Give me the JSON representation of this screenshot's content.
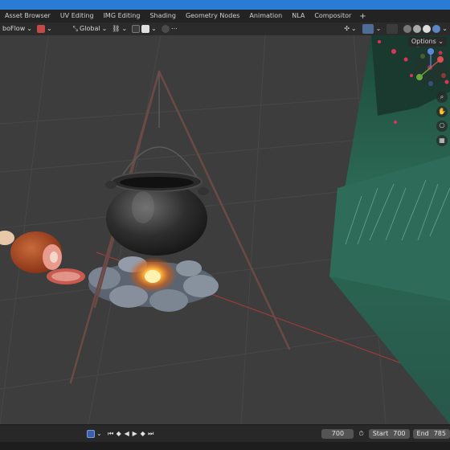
{
  "workspace_tabs": [
    "Asset Browser",
    "UV Editing",
    "IMG Editing",
    "Shading",
    "Geometry Nodes",
    "Animation",
    "NLA",
    "Compositor"
  ],
  "add_tab_symbol": "+",
  "header": {
    "mode_label": "boFlow",
    "orientation_label": "Global",
    "options_label": "Options"
  },
  "timeline": {
    "current_frame": "700",
    "start_label": "Start",
    "start_value": "700",
    "end_label": "End",
    "end_value": "785"
  },
  "colors": {
    "accent": "#2a7bd3",
    "viewport_bg": "#3d3d3d",
    "grid_line": "#474747",
    "x_axis": "#9c3b3b"
  },
  "icons": {
    "nav": [
      "zoom-icon",
      "hand-pan-icon",
      "camera-view-icon",
      "grid-ortho-icon"
    ],
    "playback": [
      "jump-start-icon",
      "prev-keyframe-icon",
      "play-reverse-icon",
      "play-icon",
      "next-keyframe-icon",
      "jump-end-icon"
    ]
  }
}
